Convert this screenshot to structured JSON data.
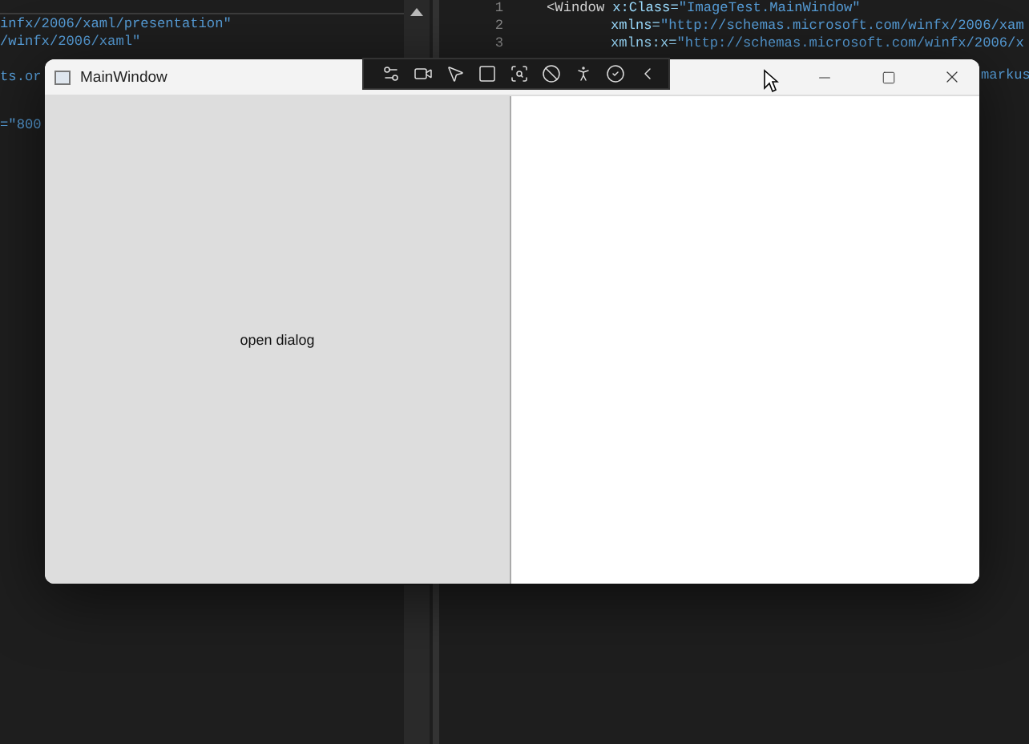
{
  "editor": {
    "left_lines": [
      {
        "text": "infx/2006/xaml/presentation\""
      },
      {
        "text": "/winfx/2006/xaml\""
      },
      {
        "text": "ts.or"
      },
      {
        "text": "=\"800"
      }
    ],
    "right_lines": [
      {
        "number": "1",
        "segments": [
          {
            "kind": "tag",
            "text": "<Window"
          },
          {
            "kind": "attr",
            "text": "x:Class="
          },
          {
            "kind": "value",
            "text": "\"ImageTest.MainWindow\""
          }
        ]
      },
      {
        "number": "2",
        "segments": [
          {
            "kind": "attr",
            "text": "xmlns="
          },
          {
            "kind": "value",
            "text": "\"http://schemas.microsoft.com/winfx/2006/xam"
          }
        ]
      },
      {
        "number": "3",
        "segments": [
          {
            "kind": "attr",
            "text": "xmlns:x="
          },
          {
            "kind": "value",
            "text": "\"http://schemas.microsoft.com/winfx/2006/x"
          }
        ]
      }
    ],
    "side_fragment": "markus"
  },
  "window": {
    "title": "MainWindow",
    "button": "open dialog"
  }
}
